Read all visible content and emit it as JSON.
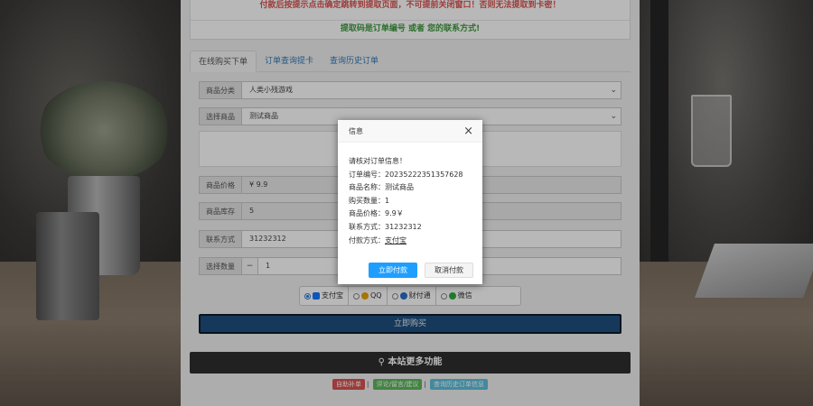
{
  "notice": {
    "line1": "付款后按提示点击确定跳转到提取页面，不可提前关闭窗口！否则无法提取到卡密！",
    "line2": "提取码是订单编号 或者 您的联系方式!"
  },
  "tabs": [
    {
      "label": "在线购买下单"
    },
    {
      "label": "订单查询提卡"
    },
    {
      "label": "查询历史订单"
    }
  ],
  "form": {
    "category": {
      "label": "商品分类",
      "value": "人类小残游戏"
    },
    "product": {
      "label": "选择商品",
      "value": "测试商品"
    },
    "price": {
      "label": "商品价格",
      "value": "¥ 9.9"
    },
    "stock": {
      "label": "商品库存",
      "value": "5"
    },
    "contact": {
      "label": "联系方式",
      "value": "31232312"
    },
    "quantity": {
      "label": "选择数量",
      "minus": "−",
      "value": "1"
    }
  },
  "payment": {
    "options": [
      {
        "label": "支付宝",
        "selected": true,
        "color": "#1677ff"
      },
      {
        "label": "QQ",
        "selected": false,
        "color": "#e8a300"
      },
      {
        "label": "财付通",
        "selected": false,
        "color": "#2a6fc9"
      },
      {
        "label": "微信",
        "selected": false,
        "color": "#2aae3d"
      }
    ]
  },
  "buy_button": "立即购买",
  "more": {
    "title": "本站更多功能",
    "links": [
      {
        "label": "自助补单",
        "color": "#d9534f"
      },
      {
        "label": "评论/留言/建议",
        "color": "#5cb85c"
      },
      {
        "label": "查询历史订单信息",
        "color": "#5bc0de"
      }
    ]
  },
  "dialog": {
    "title": "信息",
    "close": "×",
    "lines": [
      "请核对订单信息！",
      "订单编号：20235222351357628",
      "商品名称：测试商品",
      "购买数量：1",
      "商品价格：9.9￥",
      "联系方式：31232312"
    ],
    "pay_method_label": "付款方式：",
    "pay_method_value": "支付宝",
    "confirm": "立即付款",
    "cancel": "取消付款"
  }
}
